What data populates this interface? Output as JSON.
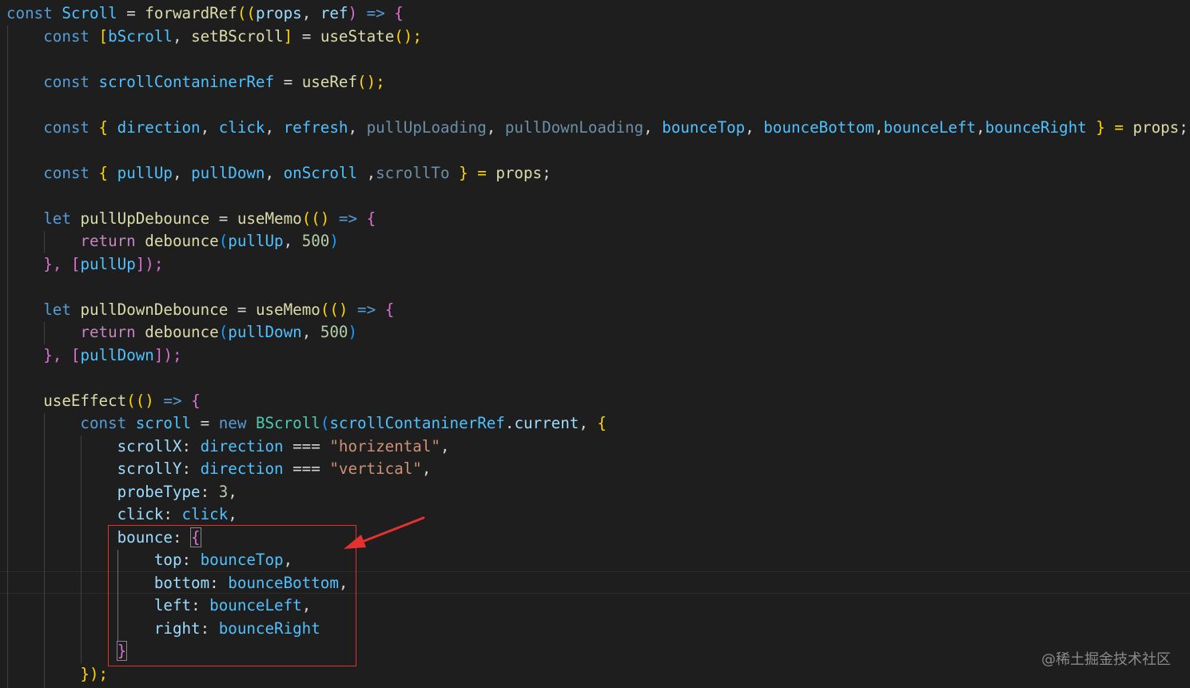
{
  "code": {
    "line1": {
      "const": "const",
      "scroll": "Scroll",
      "eq": " = ",
      "forwardRef": "forwardRef",
      "open": "((",
      "props": "props",
      "comma": ", ",
      "ref": "ref",
      "close": ") ",
      "arrow": "=>",
      "brace": " {"
    },
    "line2": {
      "const": "const",
      "open": " [",
      "bScroll": "bScroll",
      "comma": ", ",
      "setBScroll": "setBScroll",
      "close": "]",
      "eq": " = ",
      "useState": "useState",
      "call": "();"
    },
    "line4": {
      "const": "const",
      "ref": "scrollContaninerRef",
      "eq": " = ",
      "useRef": "useRef",
      "call": "();"
    },
    "line6": {
      "const": "const",
      "open": " { ",
      "direction": "direction",
      "c1": ", ",
      "click": "click",
      "c2": ", ",
      "refresh": "refresh",
      "c3": ", ",
      "pullUpLoading": "pullUpLoading",
      "c4": ", ",
      "pullDownLoading": "pullDownLoading",
      "c5": ", ",
      "bounceTop": "bounceTop",
      "c6": ", ",
      "bounceBottom": "bounceBottom",
      "c7": ",",
      "bounceLeft": "bounceLeft",
      "c8": ",",
      "bounceRight": "bounceRight",
      "close": " } = ",
      "props": "props",
      "semi": ";"
    },
    "line8": {
      "const": "const",
      "open": " { ",
      "pullUp": "pullUp",
      "c1": ", ",
      "pullDown": "pullDown",
      "c2": ", ",
      "onScroll": "onScroll",
      "c3": " ,",
      "scrollTo": "scrollTo",
      "close": " } = ",
      "props": "props",
      "semi": ";"
    },
    "line10": {
      "let": "let",
      "name": "pullUpDebounce",
      "eq": " = ",
      "useMemo": "useMemo",
      "open": "(() ",
      "arrow": "=>",
      "brace": " {"
    },
    "line11": {
      "ret": "return",
      "debounce": "debounce",
      "open": "(",
      "arg": "pullUp",
      "comma": ", ",
      "num": "500",
      "close": ")"
    },
    "line12": {
      "close": "}, [",
      "dep": "pullUp",
      "end": "]);"
    },
    "line14": {
      "let": "let",
      "name": "pullDownDebounce",
      "eq": " = ",
      "useMemo": "useMemo",
      "open": "(() ",
      "arrow": "=>",
      "brace": " {"
    },
    "line15": {
      "ret": "return",
      "debounce": "debounce",
      "open": "(",
      "arg": "pullDown",
      "comma": ", ",
      "num": "500",
      "close": ")"
    },
    "line16": {
      "close": "}, [",
      "dep": "pullDown",
      "end": "]);"
    },
    "line18": {
      "useEffect": "useEffect",
      "open": "(() ",
      "arrow": "=>",
      "brace": " {"
    },
    "line19": {
      "const": "const",
      "scroll": "scroll",
      "eq": " = ",
      "new": "new",
      "cls": "BScroll",
      "open": "(",
      "ref": "scrollContaninerRef",
      "dot": ".",
      "current": "current",
      "comma": ", ",
      "brace": "{"
    },
    "line20": {
      "key": "scrollX",
      "colon": ": ",
      "var": "direction",
      "op": " === ",
      "str": "\"horizental\"",
      "comma": ","
    },
    "line21": {
      "key": "scrollY",
      "colon": ": ",
      "var": "direction",
      "op": " === ",
      "str": "\"vertical\"",
      "comma": ","
    },
    "line22": {
      "key": "probeType",
      "colon": ": ",
      "num": "3",
      "comma": ","
    },
    "line23": {
      "key": "click",
      "colon": ": ",
      "var": "click",
      "comma": ","
    },
    "line24": {
      "key": "bounce",
      "colon": ": ",
      "brace": "{"
    },
    "line25": {
      "key": "top",
      "colon": ": ",
      "var": "bounceTop",
      "comma": ","
    },
    "line26": {
      "key": "bottom",
      "colon": ": ",
      "var": "bounceBottom",
      "comma": ","
    },
    "line27": {
      "key": "left",
      "colon": ": ",
      "var": "bounceLeft",
      "comma": ","
    },
    "line28": {
      "key": "right",
      "colon": ": ",
      "var": "bounceRight"
    },
    "line29": {
      "brace": "}"
    },
    "line30": {
      "close": "});"
    }
  },
  "watermark": "@稀土掘金技术社区",
  "colors": {
    "background": "#1e1e1e",
    "annotation": "#e5312f"
  }
}
